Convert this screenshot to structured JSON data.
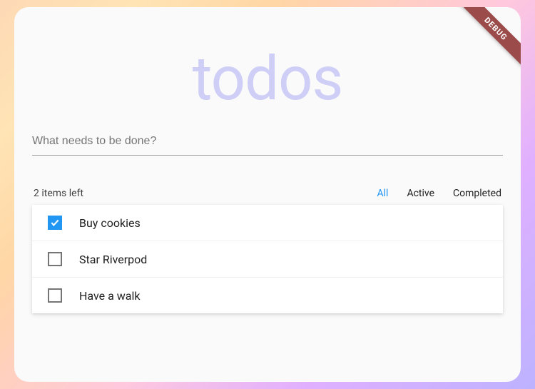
{
  "debug_label": "DEBUG",
  "title": "todos",
  "input": {
    "placeholder": "What needs to be done?",
    "value": ""
  },
  "items_left": "2 items left",
  "filters": {
    "all": "All",
    "active": "Active",
    "completed": "Completed",
    "selected": "all"
  },
  "todos": [
    {
      "label": "Buy cookies",
      "done": true
    },
    {
      "label": "Star Riverpod",
      "done": false
    },
    {
      "label": "Have a walk",
      "done": false
    }
  ]
}
